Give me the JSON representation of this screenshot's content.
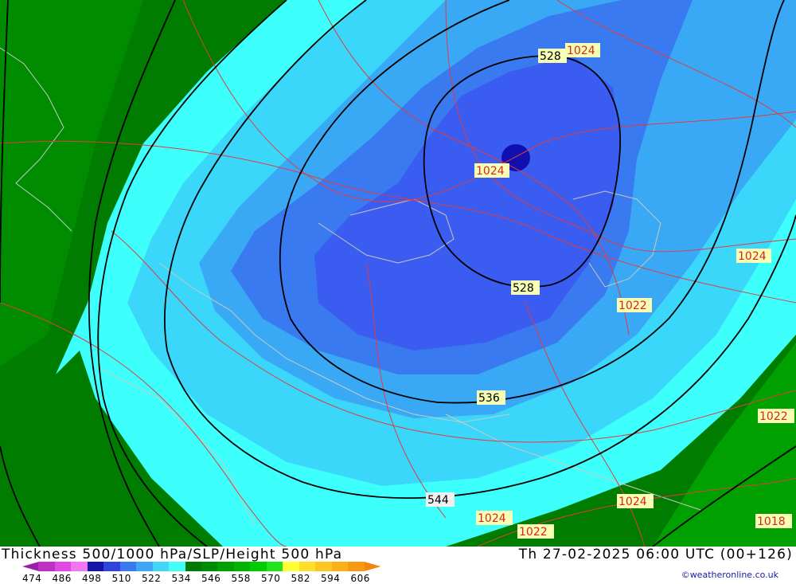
{
  "header": {
    "title": "Thickness 500/1000 hPa/SLP/Height 500 hPa",
    "valid_time": "Th 27-02-2025 06:00 UTC (00+126)"
  },
  "credit": "©weatheronline.co.uk",
  "legend": {
    "ticks": [
      "474",
      "486",
      "498",
      "510",
      "522",
      "534",
      "546",
      "558",
      "570",
      "582",
      "594",
      "606"
    ],
    "colors": [
      "#9b1fa5",
      "#c02fc4",
      "#e246e4",
      "#f276f2",
      "#1414a8",
      "#2e44df",
      "#3a78f0",
      "#3ea6f5",
      "#3fd6fa",
      "#3ffff8",
      "#007a00",
      "#008c00",
      "#00a000",
      "#00b400",
      "#00cc00",
      "#21e51b",
      "#ffff33",
      "#ffdf2a",
      "#ffc520",
      "#fbb018",
      "#f79a10",
      "#f58408"
    ]
  },
  "map": {
    "colors": {
      "green_dark": "#007d00",
      "green": "#008c00",
      "green_light": "#00a000",
      "cyan_bright": "#3dfffb",
      "cyan": "#3ad7fb",
      "blue_light": "#3aa9f5",
      "blue_mid": "#3a7af0",
      "blue": "#3a5cf0",
      "blue_deep": "#1010b0",
      "isobar": "#e03c3c",
      "coast": "#c8c8c8",
      "height_line": "#000000"
    },
    "height_labels": [
      {
        "text": "528",
        "id": "h528a"
      },
      {
        "text": "528",
        "id": "h528b"
      },
      {
        "text": "536",
        "id": "h536"
      },
      {
        "text": "544",
        "id": "h544"
      }
    ],
    "pressure_labels": [
      {
        "text": "1024",
        "id": "p1"
      },
      {
        "text": "1024",
        "id": "p2"
      },
      {
        "text": "1024",
        "id": "p3"
      },
      {
        "text": "1022",
        "id": "p4"
      },
      {
        "text": "1022",
        "id": "p5"
      },
      {
        "text": "1024",
        "id": "p6"
      },
      {
        "text": "1024",
        "id": "p7"
      },
      {
        "text": "1022",
        "id": "p8"
      },
      {
        "text": "1018",
        "id": "p9"
      }
    ]
  }
}
